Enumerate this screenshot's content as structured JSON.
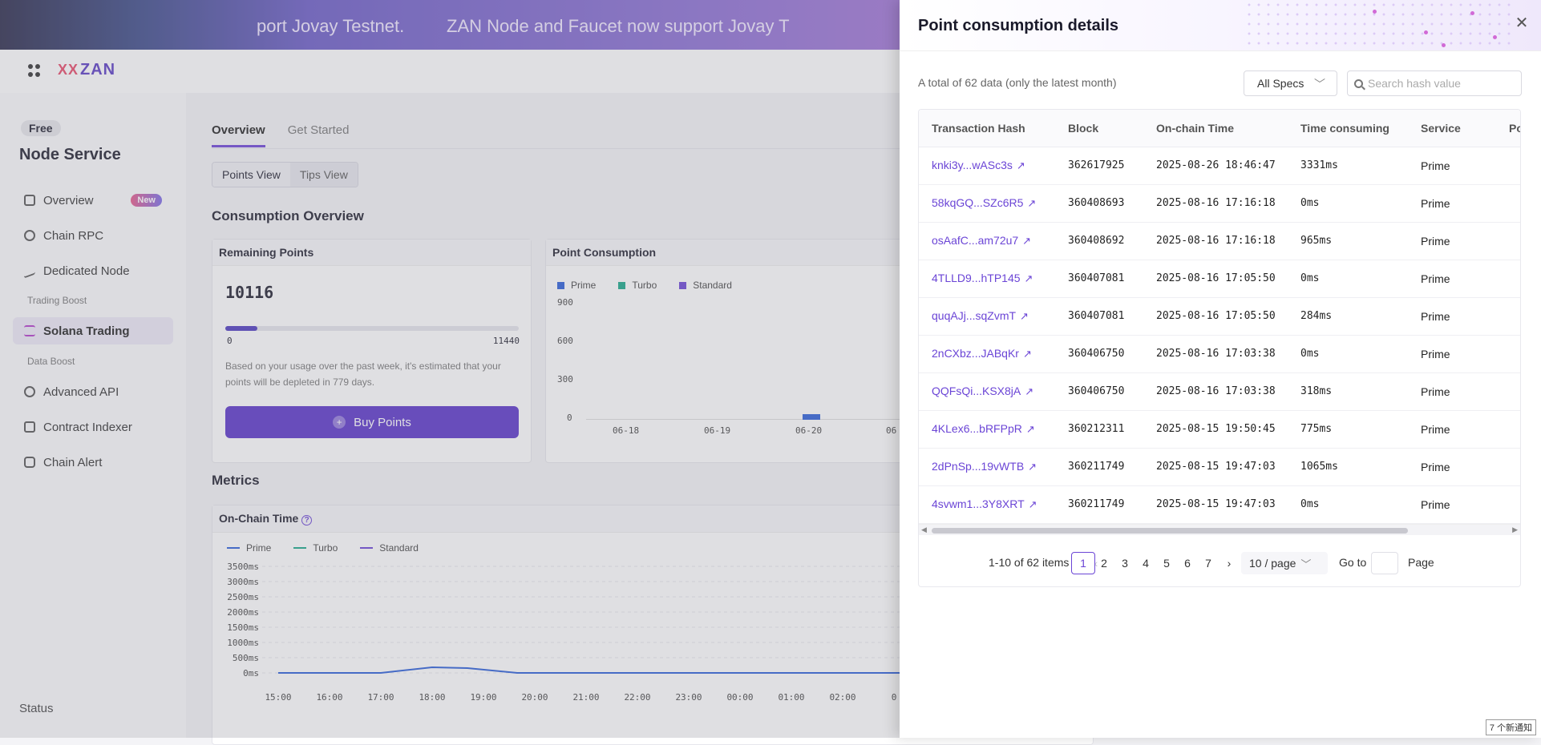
{
  "banner": {
    "msg1": "port Jovay Testnet.",
    "msg2": "ZAN Node and Faucet now support Jovay T"
  },
  "brand": {
    "logo_mark": "XX",
    "logo_text": "ZAN"
  },
  "sidebar": {
    "plan_badge": "Free",
    "service_title": "Node Service",
    "items": [
      {
        "label": "Overview",
        "icon": "chart-icon",
        "badge": "New"
      },
      {
        "label": "Chain RPC",
        "icon": "network-icon"
      },
      {
        "label": "Dedicated Node",
        "icon": "line-chart-icon"
      }
    ],
    "group_trading": "Trading Boost",
    "solana": {
      "label": "Solana Trading",
      "icon": "solana-icon"
    },
    "group_data": "Data Boost",
    "data_items": [
      {
        "label": "Advanced API",
        "icon": "api-icon"
      },
      {
        "label": "Contract Indexer",
        "icon": "indexer-icon"
      },
      {
        "label": "Chain Alert",
        "icon": "alert-icon"
      }
    ],
    "status": "Status"
  },
  "main": {
    "tabs": [
      "Overview",
      "Get Started"
    ],
    "views": [
      "Points View",
      "Tips View"
    ],
    "consumption_title": "Consumption Overview",
    "remaining": {
      "title": "Remaining Points",
      "value": "10116",
      "min": "0",
      "max": "11440",
      "fraction": 0.11,
      "estimate": "Based on your usage over the past week, it's estimated that your points will be depleted in 779 days.",
      "buy_label": "Buy Points"
    },
    "point_consumption": {
      "title": "Point Consumption",
      "legend": [
        "Prime",
        "Turbo",
        "Standard"
      ],
      "yticks": [
        "900",
        "600",
        "300",
        "0"
      ],
      "xticks": [
        "06-18",
        "06-19",
        "06-20",
        "06"
      ]
    },
    "metrics_title": "Metrics",
    "onchain": {
      "title": "On-Chain Time",
      "legend": [
        "Prime",
        "Turbo",
        "Standard"
      ],
      "yticks": [
        "3500ms",
        "3000ms",
        "2500ms",
        "2000ms",
        "1500ms",
        "1000ms",
        "500ms",
        "0ms"
      ],
      "xticks": [
        "15:00",
        "16:00",
        "17:00",
        "18:00",
        "19:00",
        "20:00",
        "21:00",
        "22:00",
        "23:00",
        "00:00",
        "01:00",
        "02:00",
        "0"
      ]
    }
  },
  "drawer": {
    "title": "Point consumption details",
    "total_text": "A total of 62 data (only the latest month)",
    "specs_label": "All Specs",
    "search_placeholder": "Search hash value",
    "columns": [
      "Transaction Hash",
      "Block",
      "On-chain Time",
      "Time consuming",
      "Service",
      "Po"
    ],
    "rows": [
      {
        "hash": "knki3y...wASc3s",
        "block": "362617925",
        "time": "2025-08-26 18:46:47",
        "consuming": "3331ms",
        "service": "Prime"
      },
      {
        "hash": "58kqGQ...SZc6R5",
        "block": "360408693",
        "time": "2025-08-16 17:16:18",
        "consuming": "0ms",
        "service": "Prime"
      },
      {
        "hash": "osAafC...am72u7",
        "block": "360408692",
        "time": "2025-08-16 17:16:18",
        "consuming": "965ms",
        "service": "Prime"
      },
      {
        "hash": "4TLLD9...hTP145",
        "block": "360407081",
        "time": "2025-08-16 17:05:50",
        "consuming": "0ms",
        "service": "Prime"
      },
      {
        "hash": "quqAJj...sqZvmT",
        "block": "360407081",
        "time": "2025-08-16 17:05:50",
        "consuming": "284ms",
        "service": "Prime"
      },
      {
        "hash": "2nCXbz...JABqKr",
        "block": "360406750",
        "time": "2025-08-16 17:03:38",
        "consuming": "0ms",
        "service": "Prime"
      },
      {
        "hash": "QQFsQi...KSX8jA",
        "block": "360406750",
        "time": "2025-08-16 17:03:38",
        "consuming": "318ms",
        "service": "Prime"
      },
      {
        "hash": "4KLex6...bRFPpR",
        "block": "360212311",
        "time": "2025-08-15 19:50:45",
        "consuming": "775ms",
        "service": "Prime"
      },
      {
        "hash": "2dPnSp...19vWTB",
        "block": "360211749",
        "time": "2025-08-15 19:47:03",
        "consuming": "1065ms",
        "service": "Prime"
      },
      {
        "hash": "4svwm1...3Y8XRT",
        "block": "360211749",
        "time": "2025-08-15 19:47:03",
        "consuming": "0ms",
        "service": "Prime"
      }
    ],
    "pagination": {
      "range": "1-10 of 62 items",
      "pages": [
        "1",
        "2",
        "3",
        "4",
        "5",
        "6",
        "7"
      ],
      "current": "1",
      "page_size": "10 / page",
      "goto": "Go to",
      "page_word": "Page"
    }
  },
  "notification": "7 个新通知",
  "colors": {
    "accent": "#6b45d6",
    "button": "#5a35c9",
    "prime": "#2b5fd9",
    "turbo": "#1aa88a",
    "standard": "#6b45d6"
  }
}
